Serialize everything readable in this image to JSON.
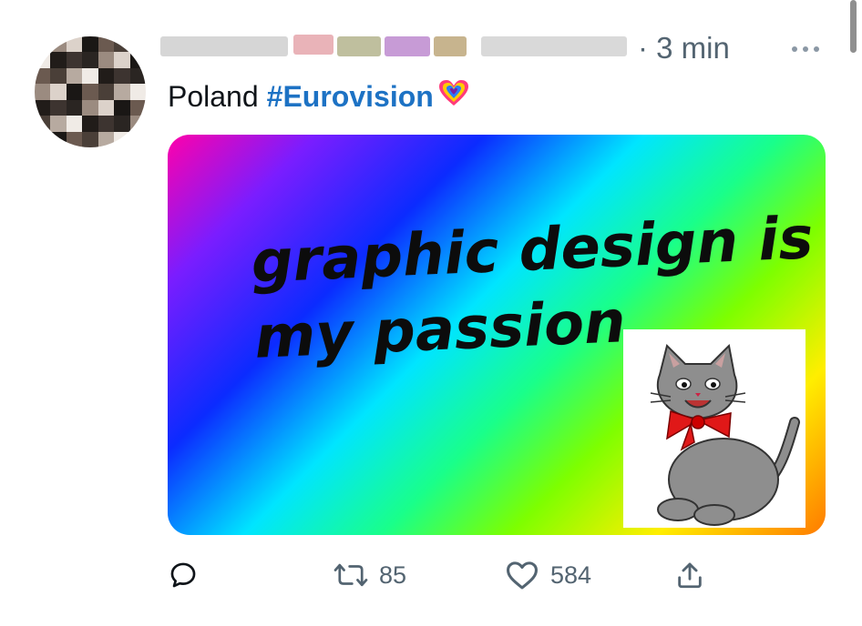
{
  "tweet": {
    "timestamp": "· 3 min",
    "text": "Poland",
    "hashtag": "#Eurovision"
  },
  "media": {
    "meme_text_line1": "graphic design is",
    "meme_text_line2": "my passion."
  },
  "actions": {
    "retweet_count": "85",
    "like_count": "584"
  },
  "icons": [
    "more-icon",
    "eurovision-heart-icon",
    "reply-icon",
    "retweet-icon",
    "like-icon",
    "share-icon"
  ],
  "colors": {
    "hashtag": "#1d72c4",
    "muted": "#536471"
  }
}
